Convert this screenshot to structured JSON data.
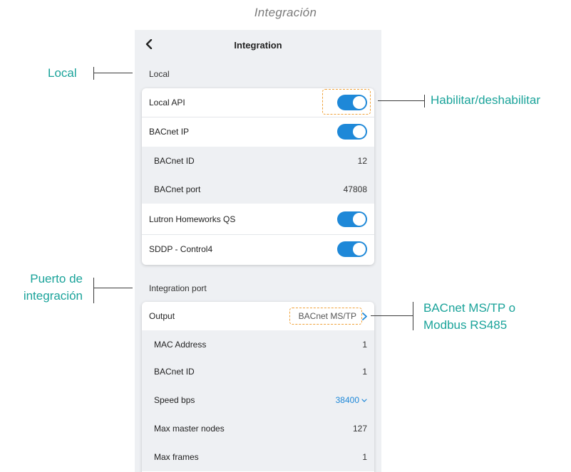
{
  "caption": "Integración",
  "header": {
    "title": "Integration"
  },
  "local_section": {
    "label": "Local",
    "local_api": {
      "label": "Local API",
      "enabled": true
    },
    "bacnet_ip": {
      "label": "BACnet IP",
      "enabled": true
    },
    "bacnet_id": {
      "label": "BACnet ID",
      "value": "12"
    },
    "bacnet_port": {
      "label": "BACnet port",
      "value": "47808"
    },
    "lutron": {
      "label": "Lutron Homeworks QS",
      "enabled": true
    },
    "sddp": {
      "label": "SDDP - Control4",
      "enabled": true
    }
  },
  "integration_section": {
    "label": "Integration port",
    "output": {
      "label": "Output",
      "value": "BACnet MS/TP"
    },
    "mac_address": {
      "label": "MAC Address",
      "value": "1"
    },
    "bacnet_id": {
      "label": "BACnet ID",
      "value": "1"
    },
    "speed": {
      "label": "Speed bps",
      "value": "38400"
    },
    "max_master": {
      "label": "Max master nodes",
      "value": "127"
    },
    "max_frames": {
      "label": "Max frames",
      "value": "1"
    }
  },
  "annotations": {
    "local": "Local",
    "toggle": "Habilitar/deshabilitar",
    "port_line1": "Puerto de",
    "port_line2": "integración",
    "output_line1": "BACnet MS/TP o",
    "output_line2": "Modbus RS485"
  },
  "colors": {
    "accent": "#1e88d8",
    "annotation": "#1aa39a",
    "highlight": "#f0a23a"
  }
}
